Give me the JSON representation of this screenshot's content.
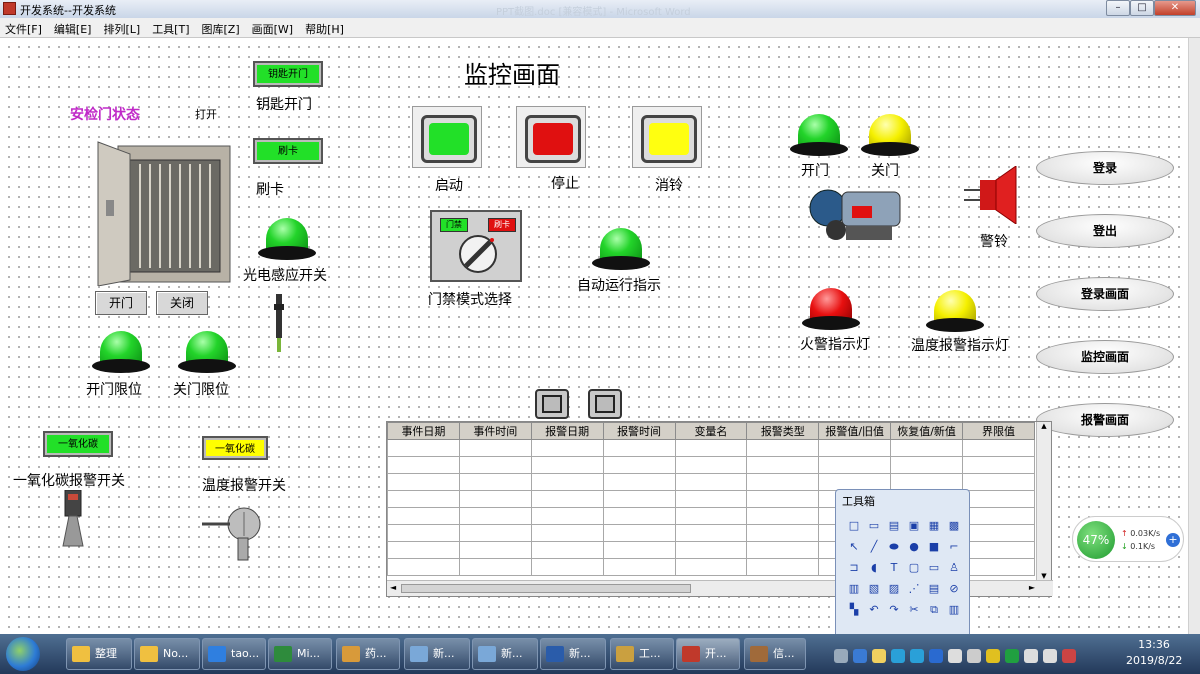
{
  "window": {
    "title": "开发系统--开发系统",
    "ghost_title": "PPT截图.doc [兼容模式] - Microsoft Word",
    "min": "–",
    "max": "□",
    "close": "✕"
  },
  "menu": [
    "文件[F]",
    "编辑[E]",
    "排列[L]",
    "工具[T]",
    "图库[Z]",
    "画面[W]",
    "帮助[H]"
  ],
  "page_title": "监控画面",
  "gate": {
    "title": "安检门状态",
    "state": "打开",
    "open_button": "开门",
    "close_button": "关闭"
  },
  "key_open": {
    "button": "钥匙开门",
    "label": "钥匙开门"
  },
  "card": {
    "button": "刷卡",
    "label": "刷卡"
  },
  "photo_switch_label": "光电感应开关",
  "door_open_limit_label": "开门限位",
  "door_close_limit_label": "关门限位",
  "co": {
    "button_green": "一氧化碳",
    "button_yellow": "一氧化碳",
    "label_co": "一氧化碳报警开关",
    "label_temp": "温度报警开关"
  },
  "start_label": "启动",
  "stop_label": "停止",
  "silence_label": "消铃",
  "access_mode": {
    "label": "门禁模式选择",
    "left_tag": "门禁",
    "right_tag": "刷卡"
  },
  "auto_run_label": "自动运行指示",
  "door_open_label": "开门",
  "door_close_label": "关门",
  "alarm_bell_label": "警铃",
  "fire_light_label": "火警指示灯",
  "temp_light_label": "温度报警指示灯",
  "nav": [
    "登录",
    "登出",
    "登录画面",
    "监控画面",
    "报警画面"
  ],
  "table": {
    "headers": [
      "事件日期",
      "事件时间",
      "报警日期",
      "报警时间",
      "变量名",
      "报警类型",
      "报警值/旧值",
      "恢复值/新值",
      "界限值"
    ],
    "scroll_up": "▲",
    "scroll_down": "▼",
    "scroll_left": "◄",
    "scroll_right": "►"
  },
  "toolbox": {
    "title": "工具箱"
  },
  "netwidget": {
    "percent": "47%",
    "up": "0.03K/s",
    "down": "0.1K/s",
    "up_arrow": "↑",
    "down_arrow": "↓",
    "plus": "+"
  },
  "taskbar": [
    "整理",
    "No...",
    "tao...",
    "Mi...",
    "药...",
    "新...",
    "新...",
    "新...",
    "工...",
    "开...",
    "信..."
  ],
  "clock": {
    "time": "13:36",
    "date": "2019/8/22"
  },
  "colors": {
    "green": "#22e028",
    "red": "#e01010",
    "yellow": "#ffff00",
    "gate_title": "#c02ac8"
  }
}
